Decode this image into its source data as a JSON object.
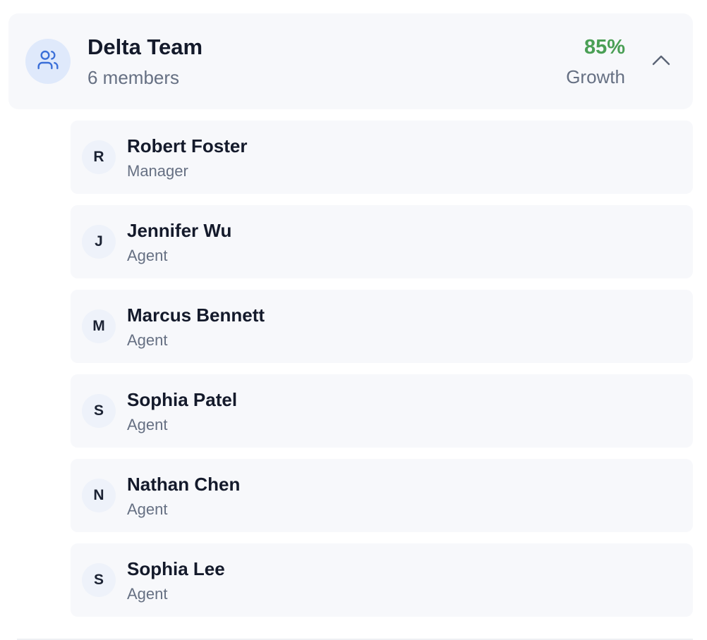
{
  "team": {
    "name": "Delta Team",
    "members_count": "6 members",
    "stat_value": "85%",
    "stat_label": "Growth",
    "expanded": true,
    "icon": "users-icon",
    "toggle_icon": "chevron-up-icon"
  },
  "colors": {
    "accent": "#3b6fd8",
    "growth": "#4a9f55"
  },
  "members": [
    {
      "initial": "R",
      "name": "Robert Foster",
      "role": "Manager"
    },
    {
      "initial": "J",
      "name": "Jennifer Wu",
      "role": "Agent"
    },
    {
      "initial": "M",
      "name": "Marcus Bennett",
      "role": "Agent"
    },
    {
      "initial": "S",
      "name": "Sophia Patel",
      "role": "Agent"
    },
    {
      "initial": "N",
      "name": "Nathan Chen",
      "role": "Agent"
    },
    {
      "initial": "S",
      "name": "Sophia Lee",
      "role": "Agent"
    }
  ]
}
